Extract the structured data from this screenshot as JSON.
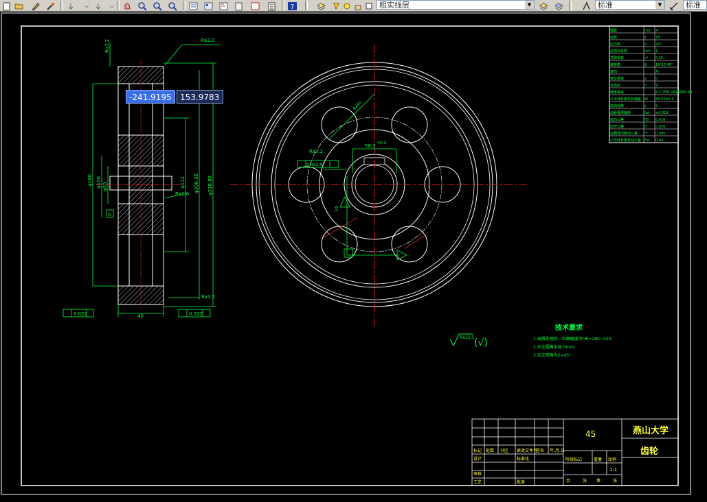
{
  "toolbar": {
    "layer_combo_value": "粗实线层",
    "style_combo_value": "标准",
    "style_combo_value_2": "标准"
  },
  "coords": {
    "x": "-241.9195",
    "y": "153.9783"
  },
  "front_view": {
    "surface_finish_top": "Ra3.2",
    "surface_finish_left": "Ra3.2",
    "dim_outer": "φ318.88",
    "dim_root": "φ306.36",
    "dim_hub": "φ180",
    "dim_hub_inner": "φ100",
    "dim_bore": "φ55",
    "dim_small": "φ56.5",
    "dim_side": "φ112",
    "finish_mid": "Ra1.6",
    "finish_bottom": "Ra3.2",
    "width": "40",
    "tol_left": "0.022",
    "tol_right": "0.022",
    "datum": "A",
    "tol_left2": "0.022 A"
  },
  "side_view": {
    "dim_keyway": "58.3",
    "dim_keyway_tol": "+0.2",
    "dim_key": "16",
    "finish_key": "Ra3.2",
    "tol_key": "0.022 A",
    "dim_bolt_circle": "φ240",
    "dim_hole": "6×φ50"
  },
  "params_table": {
    "rows": [
      [
        "模数",
        "mn",
        "4"
      ],
      [
        "齿数",
        "z",
        "78"
      ],
      [
        "压力角",
        "α",
        "20°"
      ],
      [
        "齿顶高系数",
        "ha*",
        "1"
      ],
      [
        "顶隙系数",
        "c*",
        "0.25"
      ],
      [
        "螺旋角",
        "β",
        "13°10'45\""
      ],
      [
        "旋向",
        "",
        "左"
      ],
      [
        "变位系数",
        "x",
        "0"
      ],
      [
        "全齿高",
        "h",
        "9"
      ],
      [
        "精度等级",
        "",
        "8-7-7HK GB10095-88"
      ],
      [
        "公法线长度及其偏差",
        "W",
        "89.63±0.1"
      ],
      [
        "跨测齿数",
        "k",
        "9"
      ],
      [
        "齿距极限偏差",
        "fpt",
        "±0.018"
      ],
      [
        "齿向公差",
        "Fβ",
        "0.016"
      ],
      [
        "齿形公差",
        "ff",
        "0.016"
      ],
      [
        "齿圈径向跳动公差",
        "Fr",
        "0.045"
      ],
      [
        "公法线长度变动公差",
        "Fw",
        "0.04"
      ]
    ]
  },
  "tech_req": {
    "title": "技术要求",
    "items": [
      "1.调质处理后，齿面硬度为HB=280~320;",
      "2.未注圆角半径 5mm;",
      "3.未注倒角为2×45°"
    ],
    "finish": "Ra12.5",
    "finish_paren": "(√)"
  },
  "title_block": {
    "material": "45",
    "school": "燕山大学",
    "part_name": "齿轮",
    "scale": "1:1",
    "labels": {
      "mark": "标记",
      "count": "处数",
      "zone": "分区",
      "doc_no": "更改文件号",
      "sign": "签名",
      "date": "年.月.日",
      "design": "设计",
      "standard": "标准化",
      "stage_mark": "阶段标记",
      "weight": "重量",
      "ratio": "比例",
      "check": "审核",
      "process": "工艺",
      "approve": "批准",
      "total": "共",
      "sheet": "张",
      "no": "第",
      "sheet2": "张"
    }
  }
}
